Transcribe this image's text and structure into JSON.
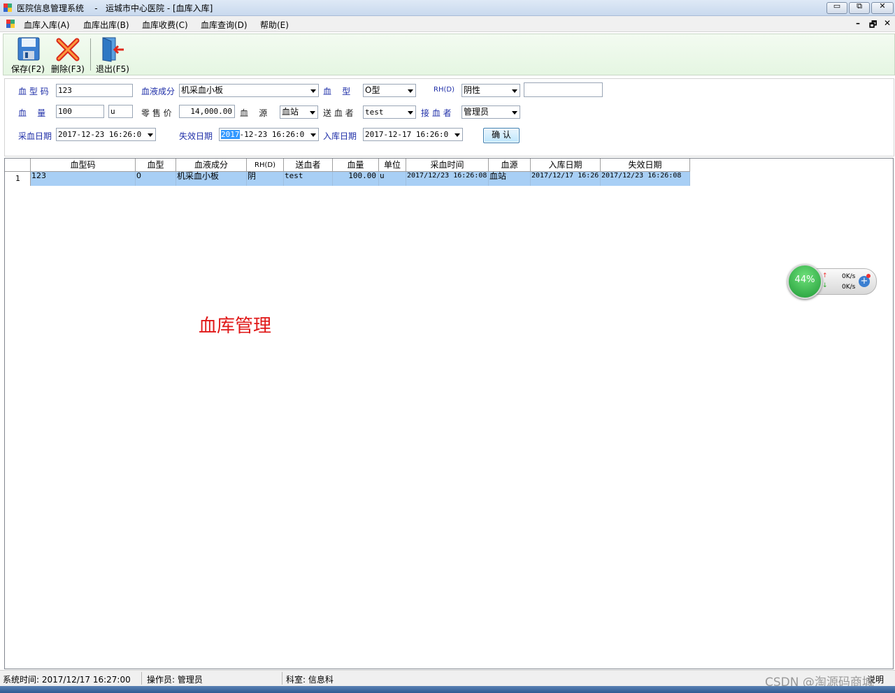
{
  "window": {
    "title": "医院信息管理系统    -   运城市中心医院 - [血库入库]",
    "minimize": "▭",
    "restore": "⧉",
    "close": "✕"
  },
  "menu": {
    "items": [
      "血库入库(A)",
      "血库出库(B)",
      "血库收费(C)",
      "血库查询(D)",
      "帮助(E)"
    ],
    "mdi_minimize": "–",
    "mdi_restore": "🗗",
    "mdi_close": "✕"
  },
  "toolbar": {
    "save_label": "保存(F2)",
    "delete_label": "删除(F3)",
    "exit_label": "退出(F5)"
  },
  "form": {
    "blood_code_label": "血 型 码",
    "blood_code_value": "123",
    "component_label": "血液成分",
    "component_value": "机采血小板",
    "blood_type_label": "血    型",
    "blood_type_value": "O型",
    "rh_label": "RH(D)",
    "rh_value": "阴性",
    "extra_value": "",
    "volume_label": "血    量",
    "volume_value": "100",
    "unit_value": "u",
    "price_label": "零 售 价",
    "price_value": "14,000.00",
    "source_label": "血    源",
    "source_value": "血站",
    "sender_label": "送 血 者",
    "sender_value": "test",
    "receiver_label": "接 血 者",
    "receiver_value": "管理员",
    "collect_date_label": "采血日期",
    "collect_date_value": "2017-12-23 16:26:0",
    "expire_date_label": "失效日期",
    "expire_date_selected": "2017",
    "expire_date_rest": "-12-23 16:26:0",
    "stock_date_label": "入库日期",
    "stock_date_value": "2017-12-17 16:26:0",
    "confirm_label": "确  认"
  },
  "grid": {
    "columns": [
      "",
      "血型码",
      "血型",
      "血液成分",
      "RH(D)",
      "送血者",
      "血量",
      "单位",
      "采血时间",
      "血源",
      "入库日期",
      "失效日期"
    ],
    "rows": [
      [
        "1",
        "123",
        "0",
        "机采血小板",
        "阴",
        "test",
        "100.00",
        "u",
        "2017/12/23 16:26:08",
        "血站",
        "2017/12/17 16:26",
        "2017/12/23 16:26:08"
      ]
    ]
  },
  "overlay_title": "血库管理",
  "net_widget": {
    "percent": "44%",
    "up_rate": "0K/s",
    "down_rate": "0K/s"
  },
  "status": {
    "system_time": "系统时间: 2017/12/17 16:27:00",
    "operator": "操作员: 管理员",
    "department": "科室: 信息科",
    "right_text": "说明"
  },
  "watermark": "CSDN @淘源码商城",
  "colors": {
    "row_highlight": "#a8cff5",
    "label_blue": "#1f2fa8",
    "overlay_red": "#e01818",
    "toolbar_green": "#e5f6e2"
  }
}
